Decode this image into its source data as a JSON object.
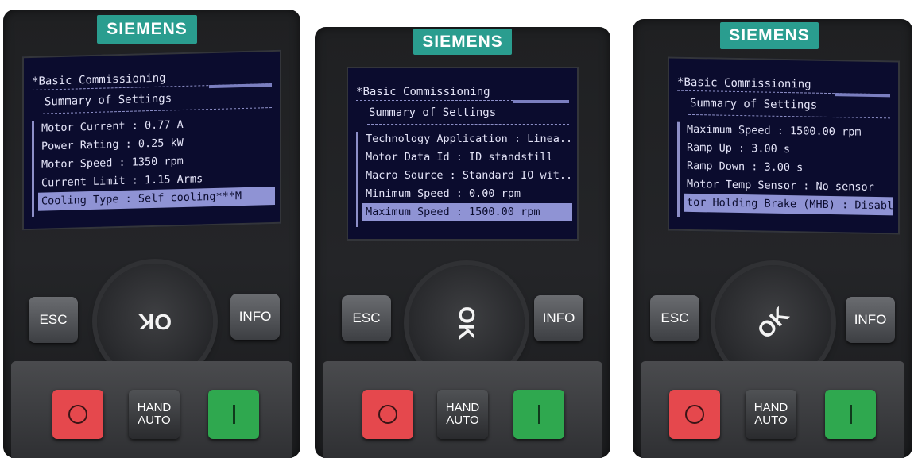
{
  "panels": [
    {
      "brand": "SIEMENS",
      "screen": {
        "title": "Basic Commissioning",
        "subtitle": "Summary of Settings",
        "items": [
          "Motor Current : 0.77 A",
          "Power Rating : 0.25 kW",
          "Motor Speed : 1350 rpm",
          "Current Limit : 1.15 Arms",
          "Cooling Type : Self cooling***M"
        ],
        "selected_index": 4
      },
      "buttons": {
        "esc": "ESC",
        "ok": "OK",
        "info": "INFO",
        "off": "O",
        "hand": "HAND",
        "auto": "AUTO",
        "on": "I"
      }
    },
    {
      "brand": "SIEMENS",
      "screen": {
        "title": "Basic Commissioning",
        "subtitle": "Summary of Settings",
        "items": [
          "Technology Application : Linea..",
          "Motor Data Id : ID standstill",
          "Macro Source : Standard IO wit..",
          "Minimum Speed : 0.00 rpm",
          "Maximum Speed : 1500.00 rpm"
        ],
        "selected_index": 4
      },
      "buttons": {
        "esc": "ESC",
        "ok": "OK",
        "info": "INFO",
        "off": "O",
        "hand": "HAND",
        "auto": "AUTO",
        "on": "I"
      }
    },
    {
      "brand": "SIEMENS",
      "screen": {
        "title": "Basic Commissioning",
        "subtitle": "Summary of Settings",
        "items": [
          "Maximum Speed : 1500.00 rpm",
          "Ramp Up : 3.00 s",
          "Ramp Down : 3.00 s",
          "Motor Temp Sensor : No sensor",
          "tor Holding Brake (MHB) : Disabl"
        ],
        "selected_index": 4
      },
      "buttons": {
        "esc": "ESC",
        "ok": "OK",
        "info": "INFO",
        "off": "O",
        "hand": "HAND",
        "auto": "AUTO",
        "on": "I"
      }
    }
  ],
  "colors": {
    "brand_teal": "#2a9d8f",
    "screen_bg": "#0b0c2e",
    "selection": "#8f93d4",
    "off_button": "#e5484d",
    "on_button": "#2fa84f"
  }
}
